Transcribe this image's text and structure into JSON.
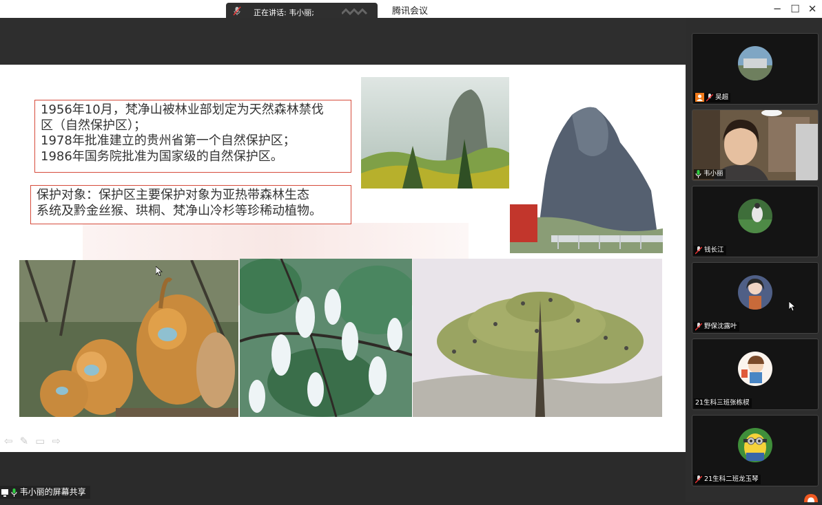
{
  "window": {
    "title": "腾讯会议",
    "speaking_text": "正在讲话: 韦小丽;",
    "minimize": "─",
    "maximize": "☐",
    "close": "✕"
  },
  "slide": {
    "paragraph1": [
      "1956年10月，梵净山被林业部划定为天然森林禁伐",
      "区（自然保护区）；",
      "1978年批准建立的贵州省第一个自然保护区；",
      "1986年国务院批准为国家级的自然保护区。"
    ],
    "paragraph2": [
      "保护对象：保护区主要保护对象为亚热带森林生态",
      "系统及黔金丝猴、珙桐、梵净山冷杉等珍稀动植物。"
    ],
    "photos": [
      "misty-mountain-photo",
      "mushroom-rock-photo",
      "golden-monkeys-photo",
      "dove-tree-photo",
      "fir-tree-photo"
    ]
  },
  "screen_share": {
    "label": "韦小丽的屏幕共享"
  },
  "participants": [
    {
      "name": "吴超",
      "mic": "muted",
      "host": true
    },
    {
      "name": "韦小丽",
      "mic": "on"
    },
    {
      "name": "钱长江",
      "mic": "muted"
    },
    {
      "name": "野保沈露叶",
      "mic": "muted"
    },
    {
      "name": "21生科三班张栋棂",
      "mic": "none"
    },
    {
      "name": "21生科二班龙玉琴",
      "mic": "muted"
    }
  ],
  "colors": {
    "accent_border": "#d64a3a",
    "mic_on": "#2ecc40",
    "host_badge": "#f07a1a"
  }
}
